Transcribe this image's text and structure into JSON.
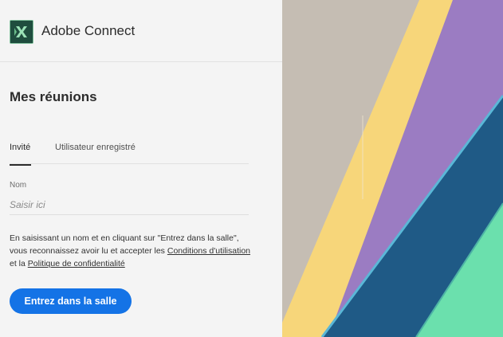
{
  "app": {
    "title": "Adobe Connect",
    "logo_icon": "adobe-connect-logo-icon"
  },
  "page": {
    "title": "Mes réunions"
  },
  "tabs": [
    {
      "label": "Invité",
      "active": true
    },
    {
      "label": "Utilisateur enregistré",
      "active": false
    }
  ],
  "form": {
    "name_label": "Nom",
    "name_placeholder": "Saisir ici",
    "name_value": ""
  },
  "legal": {
    "prefix": "En saisissant un nom et en cliquant sur \"Entrez dans la salle\", vous reconnaissez avoir lu et accepter les ",
    "terms_link": "Conditions d'utilisation",
    "middle": " et la ",
    "privacy_link": "Politique de confidentialité"
  },
  "actions": {
    "enter_label": "Entrez dans la salle"
  },
  "colors": {
    "accent": "#1473e6",
    "panel_bg": "#f4f4f4",
    "art_gray": "#c5bdb3",
    "art_yellow": "#f7d67a",
    "art_purple": "#9b7cc2",
    "art_blue": "#1f5a86",
    "art_green": "#6be0ad"
  }
}
